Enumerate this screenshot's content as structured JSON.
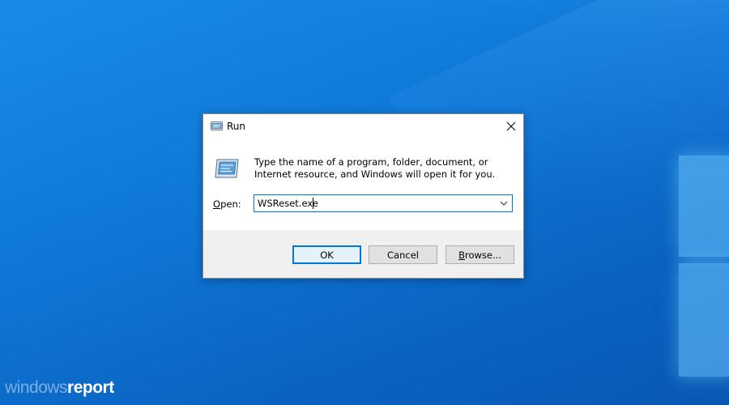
{
  "dialog": {
    "title": "Run",
    "description": "Type the name of a program, folder, document, or Internet resource, and Windows will open it for you.",
    "open_label_prefix": "",
    "open_label_accel": "O",
    "open_label_rest": "pen:",
    "open_value": "WSReset.exe",
    "buttons": {
      "ok": "OK",
      "cancel": "Cancel",
      "browse_accel": "B",
      "browse_rest": "rowse..."
    }
  },
  "watermark": {
    "light": "windows",
    "strong": "report"
  },
  "icons": {
    "title": "run-icon",
    "big": "run-icon",
    "close": "close-icon",
    "dropdown": "chevron-down-icon"
  },
  "colors": {
    "desktop": "#0f78d7",
    "focus_accent": "#0078d7",
    "footer": "#f0f0f0"
  }
}
